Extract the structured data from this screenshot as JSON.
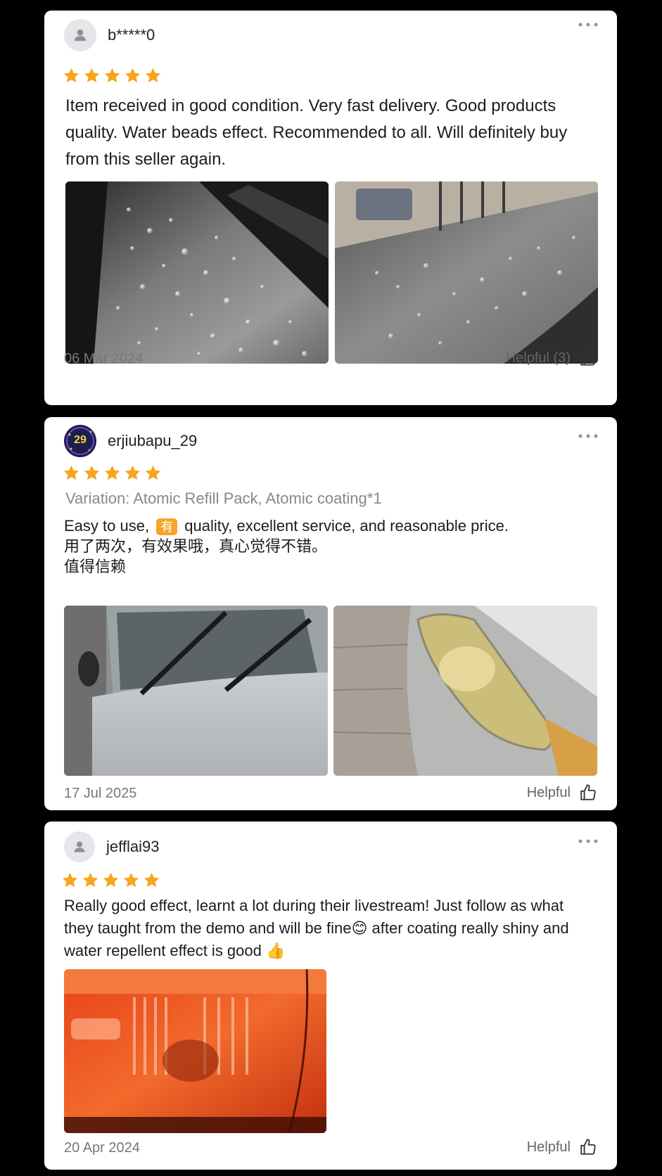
{
  "reviews": [
    {
      "username": "b*****0",
      "rating": 5,
      "text": "Item received in good condition. Very fast delivery. Good products quality. Water beads effect. Recommended to all. Will definitely buy from this seller again.",
      "date": "06 Mar 2024",
      "helpful": "Helpful (3)",
      "photos": [
        "water-beads-on-car-hood",
        "water-beads-on-car-roof"
      ]
    },
    {
      "username": "erjiubapu_29",
      "avatar_badge": "29",
      "rating": 5,
      "variation": "Variation: Atomic Refill Pack, Atomic coating*1",
      "text_part1": "Easy to use, ",
      "text_chip": "有",
      "text_part2": " quality, excellent service, and reasonable price.",
      "text_line2": "用了两次，有效果哦，真心觉得不错。",
      "text_line3": "值得信赖",
      "date": "17 Jul 2025",
      "helpful": "Helpful",
      "photos": [
        "silver-car-windshield",
        "car-headlight"
      ]
    },
    {
      "username": "jefflai93",
      "rating": 5,
      "text": "Really good effect, learnt a lot during their livestream! Just follow as what they taught from the demo and will be fine😊 after coating really shiny and water repellent effect is good 👍",
      "date": "20 Apr 2024",
      "helpful": "Helpful",
      "photos": [
        "shiny-orange-car-panel"
      ]
    }
  ],
  "colors": {
    "star": "#f7a51b",
    "background": "#000000",
    "card": "#ffffff"
  }
}
